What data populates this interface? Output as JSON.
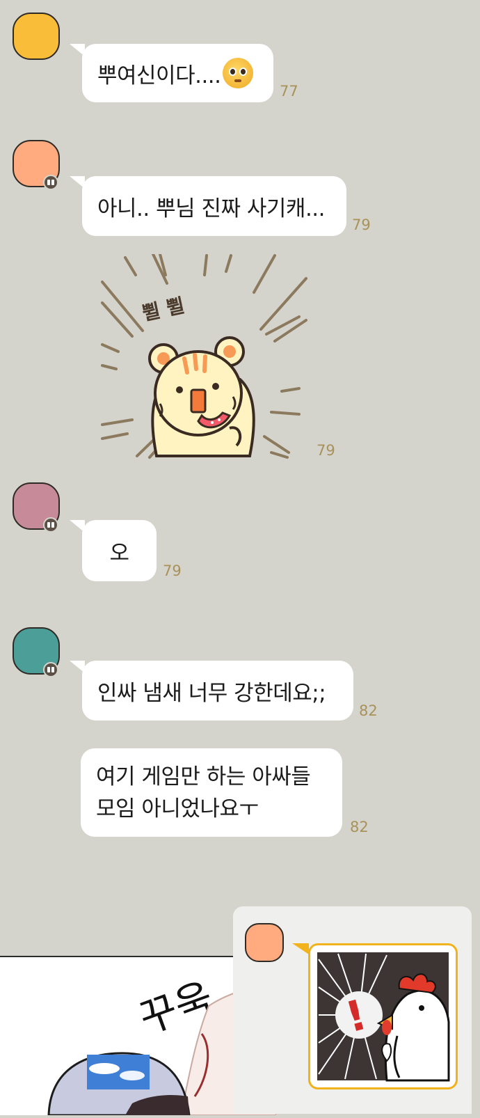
{
  "messages": [
    {
      "text": "뿌여신이다....",
      "count": "77"
    },
    {
      "text": "아니.. 뿌님 진짜 사기캐...",
      "count": "79"
    },
    {
      "sticker_text": "쀨 쀨",
      "count": "79"
    },
    {
      "text": "오",
      "count": "79"
    },
    {
      "text": "인싸 냄새 너무 강한데요;;",
      "count": "82"
    },
    {
      "text": "여기 게임만 하는 아싸들 모임 아니었나요ㅜ",
      "count": "82"
    }
  ],
  "comic": {
    "sfx": "꾸욱..",
    "alert": "!"
  },
  "colors": {
    "background": "#d4d3cc",
    "avatar_1": "#f9bd39",
    "avatar_2": "#ffab7f",
    "avatar_3": "#c68a98",
    "avatar_4": "#4c9e98",
    "avatar_5": "#ffab7f",
    "count_text": "#a8925a",
    "sticker_border": "#f1b21c"
  }
}
